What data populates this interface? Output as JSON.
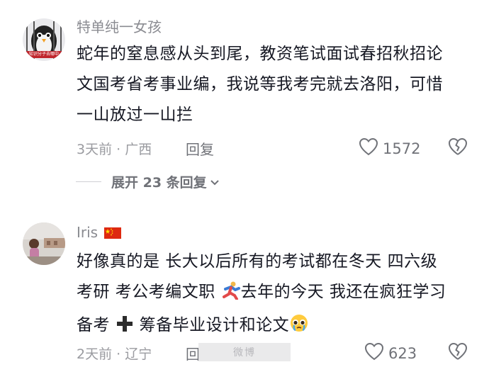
{
  "comments": [
    {
      "username": "特单纯一女孩",
      "avatar_text": "知识分子去哪中",
      "body": "蛇年的窒息感从头到尾，教资笔试面试春招秋招论文国考省考事业编，我说等我考完就去洛阳，可惜一山放过一山拦",
      "time": "3天前",
      "location": "广西",
      "reply_label": "回复",
      "like_count": "1572",
      "expand_label": "展开 23 条回复"
    },
    {
      "username": "Iris",
      "body_part1": "好像真的是 长大以后所有的考试都在冬天 四六级 考研 考公考编文职 ",
      "body_part2": "去年的今天 我还在疯狂学习备考 ",
      "body_part3": " 筹备毕业设计和论文",
      "time": "2天前",
      "location": "辽宁",
      "reply_label": "回",
      "like_count": "623",
      "overlay_text": "微博"
    }
  ],
  "icons": {
    "like": "heart-outline-icon",
    "dislike": "broken-heart-icon",
    "expand": "chevron-down-icon",
    "flag": "china-flag-icon",
    "emoji_run": "running-person-emoji",
    "emoji_plus": "plus-emoji",
    "emoji_cry": "pleading-face-emoji"
  },
  "colors": {
    "text_primary": "#161823",
    "text_secondary": "#8a8b91",
    "icon": "#707278"
  }
}
